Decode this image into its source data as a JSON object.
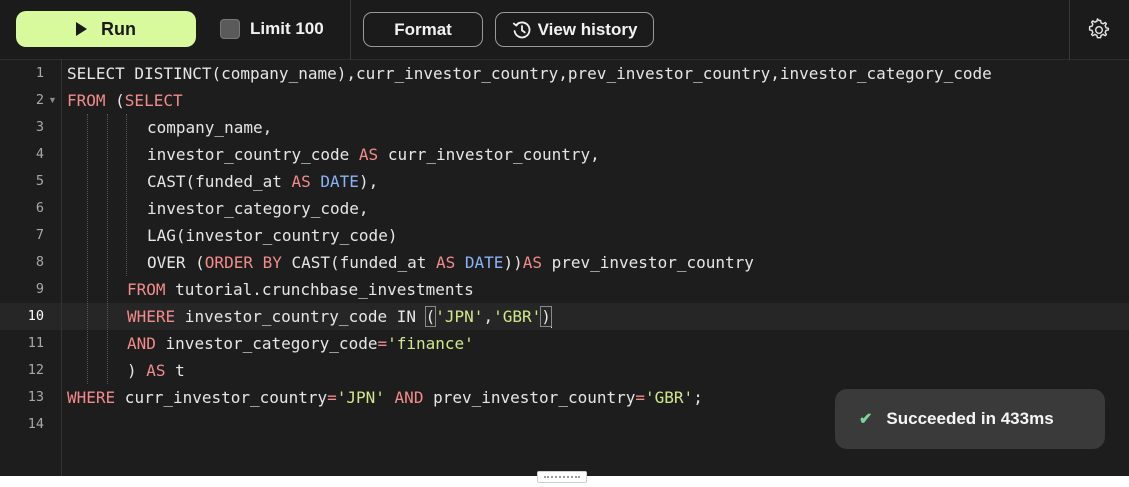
{
  "toolbar": {
    "run_label": "Run",
    "limit_label": "Limit 100",
    "format_label": "Format",
    "history_label": "View history"
  },
  "editor": {
    "line_numbers": [
      "1",
      "2",
      "3",
      "4",
      "5",
      "6",
      "7",
      "8",
      "9",
      "10",
      "11",
      "12",
      "13",
      "14"
    ],
    "lines": [
      "SELECT DISTINCT(company_name),curr_investor_country,prev_investor_country,investor_category_code",
      "FROM (SELECT",
      "company_name,",
      "investor_country_code AS curr_investor_country,",
      "CAST(funded_at AS DATE),",
      "investor_category_code,",
      "LAG(investor_country_code)",
      "OVER (ORDER BY CAST(funded_at AS DATE))AS prev_investor_country",
      "FROM tutorial.crunchbase_investments",
      "WHERE investor_country_code IN ('JPN','GBR')",
      "AND investor_category_code='finance'",
      ") AS t",
      "WHERE curr_investor_country='JPN' AND prev_investor_country='GBR';",
      ""
    ],
    "active_line": "10"
  },
  "toast": {
    "message": "Succeeded in 433ms"
  },
  "colors": {
    "run_button": "#d9f99d",
    "keyword": "#f28b8b",
    "type": "#8ab4f8",
    "string": "#cfe88a",
    "success_check": "#7ed39a"
  },
  "icons": [
    "play-icon",
    "checkbox",
    "history-icon",
    "gear-icon",
    "check-icon",
    "resize-handle"
  ]
}
